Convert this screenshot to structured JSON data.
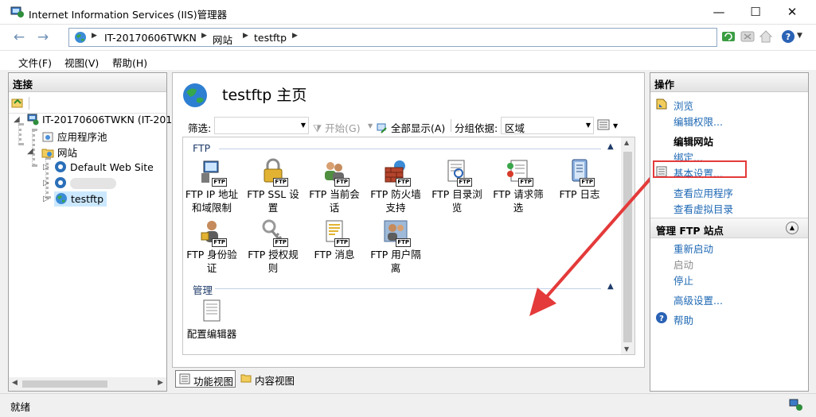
{
  "window": {
    "title": "Internet Information Services (IIS)管理器"
  },
  "breadcrumb": [
    "IT-20170606TWKN",
    "网站",
    "testftp"
  ],
  "menu": [
    "文件(F)",
    "视图(V)",
    "帮助(H)"
  ],
  "connections": {
    "title": "连接",
    "server": "IT-20170606TWKN (IT-201",
    "app_pools": "应用程序池",
    "sites": "网站",
    "site_items": [
      "Default Web Site",
      "",
      "testftp"
    ]
  },
  "main": {
    "title": "testftp 主页",
    "filter_label": "筛选:",
    "start_label": "开始(G)",
    "show_all_label": "全部显示(A)",
    "group_by_label": "分组依据:",
    "group_by_value": "区域",
    "groups": [
      {
        "name": "FTP",
        "features": [
          "FTP IP 地址和域限制",
          "FTP SSL 设置",
          "FTP 当前会话",
          "FTP 防火墙支持",
          "FTP 目录浏览",
          "FTP 请求筛选",
          "FTP 日志",
          "FTP 身份验证",
          "FTP 授权规则",
          "FTP 消息",
          "FTP 用户隔离"
        ]
      },
      {
        "name": "管理",
        "features": [
          "配置编辑器"
        ]
      }
    ],
    "badge_text": "FTP",
    "tabs": [
      "功能视图",
      "内容视图"
    ]
  },
  "actions": {
    "title": "操作",
    "browse": "浏览",
    "edit_permissions": "编辑权限...",
    "edit_site_title": "编辑网站",
    "bindings": "绑定...",
    "basic_settings": "基本设置...",
    "view_applications": "查看应用程序",
    "view_virtual_dirs": "查看虚拟目录",
    "manage_ftp_title": "管理 FTP 站点",
    "restart": "重新启动",
    "start": "启动",
    "stop": "停止",
    "advanced": "高级设置...",
    "help": "帮助"
  },
  "status": {
    "text": "就绪"
  },
  "colors": {
    "link": "#1d67b3",
    "highlight": "#e43a3a",
    "group_text": "#1e3b69",
    "selected": "#cce8ff"
  }
}
